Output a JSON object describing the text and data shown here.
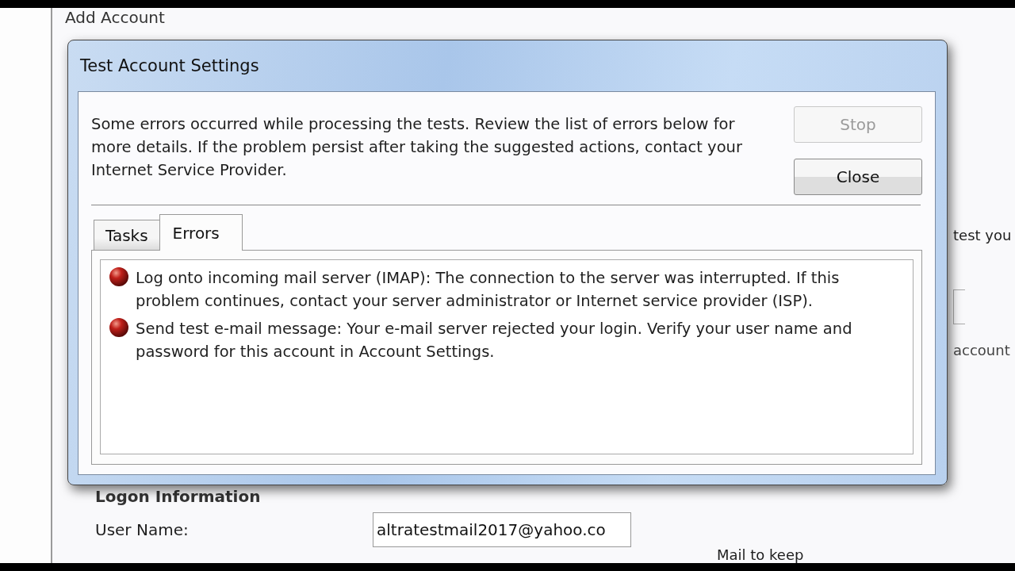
{
  "background_window": {
    "title": "Add Account",
    "side_texts": [
      "test you",
      "account"
    ],
    "section_title": "Logon Information",
    "fields": [
      {
        "label": "User Name:",
        "value": "altratestmail2017@yahoo.co"
      }
    ],
    "cut_text": "Mail to keep"
  },
  "dialog": {
    "title": "Test Account Settings",
    "message": "Some errors occurred while processing the tests. Review the list of errors below for more details. If the problem persist after taking the suggested actions, contact your Internet Service Provider.",
    "buttons": [
      {
        "label": "Stop",
        "disabled": true
      },
      {
        "label": "Close",
        "disabled": false
      }
    ],
    "tabs": [
      {
        "label": "Tasks",
        "selected": false
      },
      {
        "label": "Errors",
        "selected": true
      }
    ],
    "errors": [
      {
        "text": "Log onto incoming mail server (IMAP): The connection to the server was interrupted. If this problem continues, contact your server administrator or Internet service provider (ISP)."
      },
      {
        "text": "Send test e-mail message: Your e-mail server rejected your login. Verify your user name and password for this account in Account Settings."
      }
    ]
  }
}
